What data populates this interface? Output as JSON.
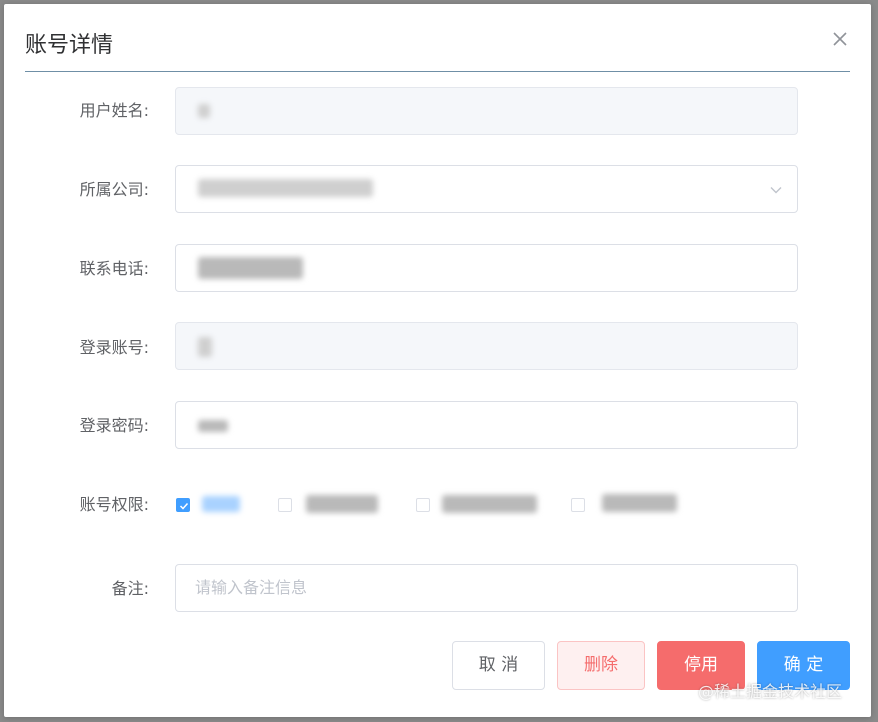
{
  "dialog": {
    "title": "账号详情",
    "close_icon": "close-icon"
  },
  "form": {
    "name_label": "用户姓名:",
    "company_label": "所属公司:",
    "phone_label": "联系电话:",
    "account_label": "登录账号:",
    "password_label": "登录密码:",
    "permissions_label": "账号权限:",
    "permissions": [
      {
        "checked": true
      },
      {
        "checked": false
      },
      {
        "checked": false
      },
      {
        "checked": false
      }
    ],
    "remark_label": "备注:",
    "remark_placeholder": "请输入备注信息"
  },
  "buttons": {
    "cancel": "取 消",
    "delete": "删除",
    "disable": "停用",
    "confirm": "确 定"
  },
  "watermark": "@稀土掘金技术社区",
  "colors": {
    "primary": "#409eff",
    "danger": "#f56c6c",
    "danger_light": "#fef0f0"
  }
}
